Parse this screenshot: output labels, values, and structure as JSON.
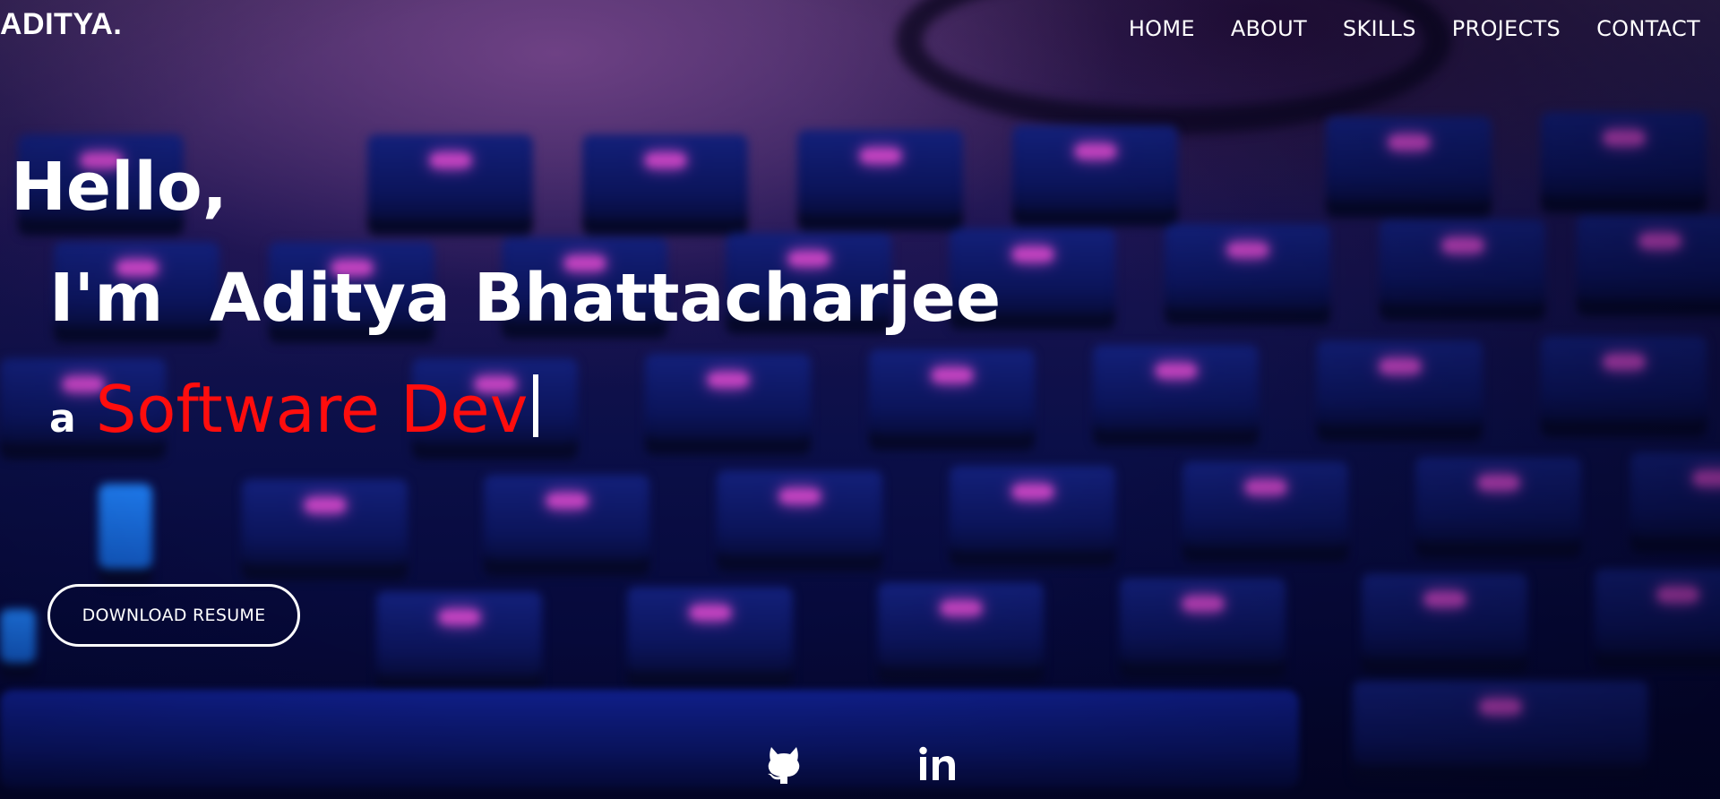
{
  "brand": {
    "logo_text": "ADITYA."
  },
  "nav": {
    "items": [
      {
        "label": "HOME"
      },
      {
        "label": "ABOUT"
      },
      {
        "label": "SKILLS"
      },
      {
        "label": "PROJECTS"
      },
      {
        "label": "CONTACT"
      }
    ]
  },
  "hero": {
    "greeting": "Hello,",
    "intro": "I'm  Aditya Bhattacharjee",
    "role_prefix": "a",
    "role_text": "Software Dev",
    "resume_button": "DOWNLOAD RESUME"
  },
  "social": {
    "links": [
      {
        "icon": "github-icon"
      },
      {
        "icon": "linkedin-icon"
      }
    ]
  },
  "colors": {
    "accent": "#ff0d0d",
    "text": "#ffffff",
    "background": "#0b0f48"
  }
}
